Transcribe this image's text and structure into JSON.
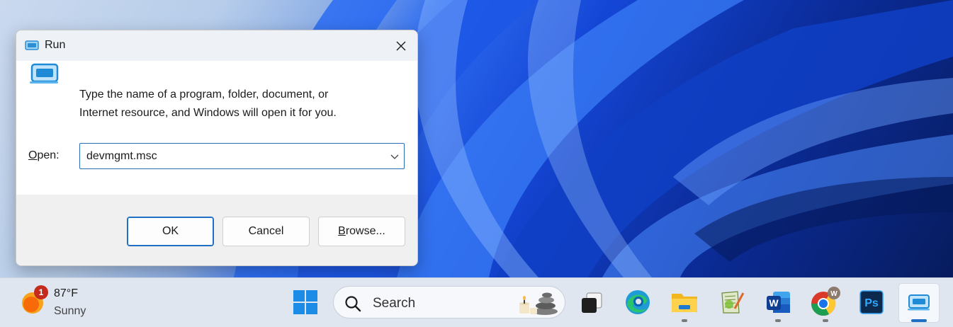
{
  "dialog": {
    "title": "Run",
    "description_line1": "Type the name of a program, folder, document, or",
    "description_line2": "Internet resource, and Windows will open it for you.",
    "open_label_mnemonic": "O",
    "open_label_rest": "pen:",
    "open_value": "devmgmt.msc",
    "ok_label": "OK",
    "cancel_label": "Cancel",
    "browse_mnemonic": "B",
    "browse_rest": "rowse..."
  },
  "taskbar": {
    "weather": {
      "badge": "1",
      "temperature": "87°F",
      "condition": "Sunny"
    },
    "search_label": "Search",
    "apps": [
      {
        "name": "Task View",
        "icon": "task-view-icon"
      },
      {
        "name": "Microsoft Edge",
        "icon": "edge-icon"
      },
      {
        "name": "File Explorer",
        "icon": "folder-icon"
      },
      {
        "name": "Notepad++",
        "icon": "notepad-icon"
      },
      {
        "name": "Microsoft Word",
        "icon": "word-icon",
        "letter": "W"
      },
      {
        "name": "Google Chrome",
        "icon": "chrome-icon",
        "badge_letter": "W"
      },
      {
        "name": "Adobe Photoshop",
        "icon": "photoshop-icon",
        "letter": "Ps"
      },
      {
        "name": "Run",
        "icon": "run-icon"
      }
    ]
  },
  "colors": {
    "accent": "#1f6fc5",
    "dialog_body": "#ffffff",
    "dialog_footer": "#f0f0f0",
    "taskbar": "#dfe6f0"
  }
}
